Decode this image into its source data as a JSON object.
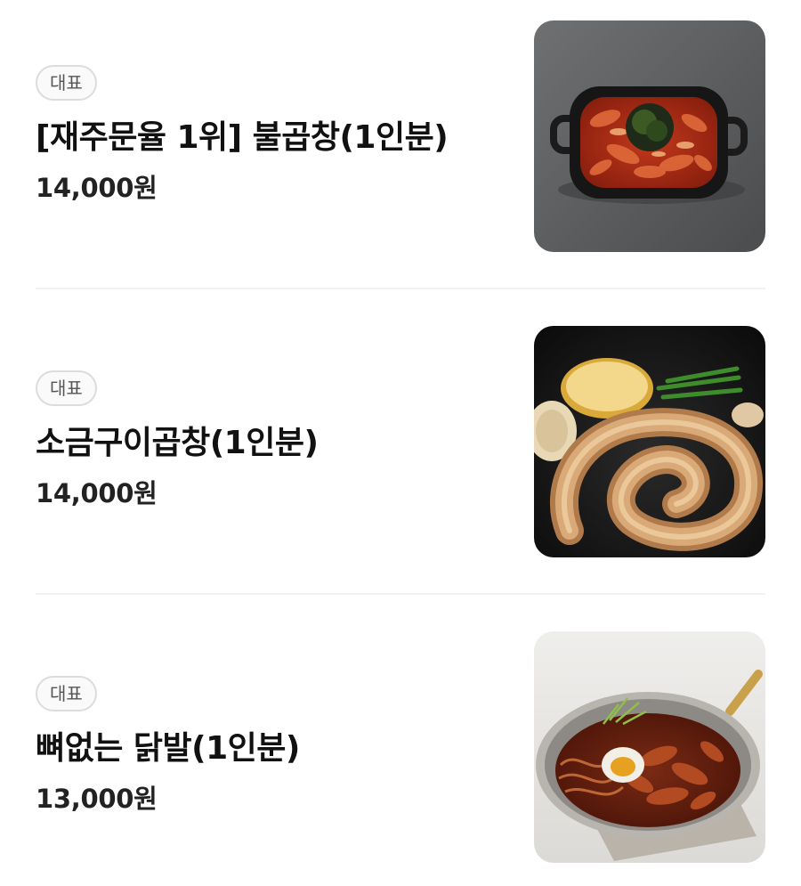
{
  "menu": {
    "items": [
      {
        "badge": "대표",
        "name": "[재주문율 1위] 불곱창(1인분)",
        "price": "14,000원",
        "image": "spicy-fire-gopchang-in-black-skillet"
      },
      {
        "badge": "대표",
        "name": "소금구이곱창(1인분)",
        "price": "14,000원",
        "image": "salt-grilled-gopchang-on-iron-pan"
      },
      {
        "badge": "대표",
        "name": "뼈없는 닭발(1인분)",
        "price": "13,000원",
        "image": "boneless-chicken-feet-in-steel-pan"
      }
    ]
  },
  "colors": {
    "text": "#111111",
    "badge_border": "#dcdcdc",
    "divider": "#f1f1f1"
  }
}
